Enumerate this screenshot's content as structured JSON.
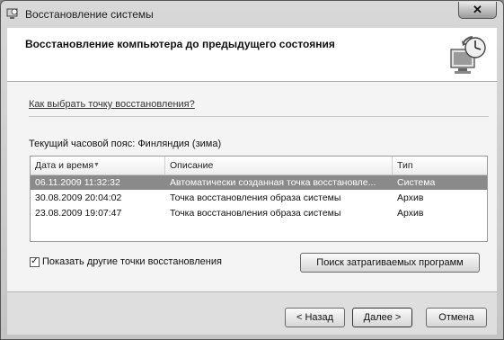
{
  "window": {
    "title": "Восстановление системы",
    "close_label": "✕"
  },
  "header": {
    "title": "Восстановление компьютера до предыдущего состояния"
  },
  "content": {
    "help_link": "Как выбрать точку восстановления?",
    "timezone_label": "Текущий часовой пояс: Финляндия (зима)",
    "columns": [
      "Дата и время",
      "Описание",
      "Тип"
    ],
    "rows": [
      {
        "date": "06.11.2009 11:32:32",
        "description": "Автоматически созданная точка восстановле...",
        "type": "Система",
        "selected": true
      },
      {
        "date": "30.08.2009 20:04:02",
        "description": "Точка восстановления образа системы",
        "type": "Архив",
        "selected": false
      },
      {
        "date": "23.08.2009 19:07:47",
        "description": "Точка восстановления образа системы",
        "type": "Архив",
        "selected": false
      }
    ],
    "show_more_label": "Показать другие точки восстановления",
    "show_more_checked": true,
    "scan_button": "Поиск затрагиваемых программ"
  },
  "footer": {
    "back_button": "< Назад",
    "next_button": "Далее >",
    "cancel_button": "Отмена"
  }
}
